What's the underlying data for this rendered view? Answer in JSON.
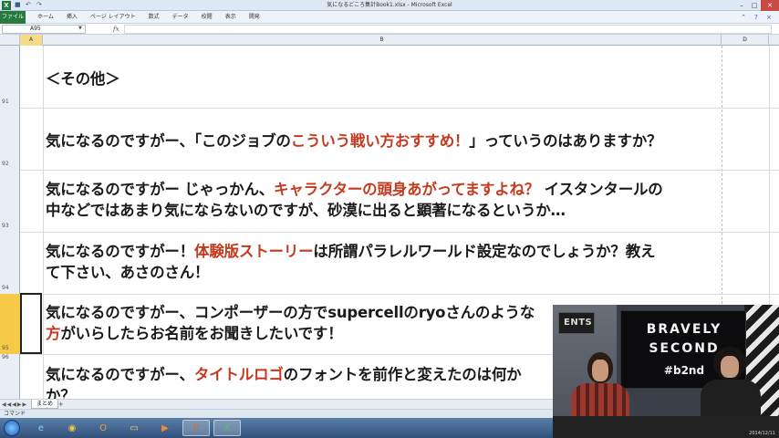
{
  "window": {
    "title": "気になるどころ集計Book1.xlsx - Microsoft Excel",
    "app_icon": "X",
    "controls": {
      "minimize": "–",
      "maximize": "□",
      "close": "✕"
    }
  },
  "ribbon": {
    "file_tab": "ファイル",
    "tabs": [
      "ホーム",
      "挿入",
      "ページ レイアウト",
      "数式",
      "データ",
      "校閲",
      "表示",
      "開発"
    ]
  },
  "formula_bar": {
    "name_box": "A95",
    "fx": "fx",
    "value": ""
  },
  "columns": [
    "A",
    "B",
    "D"
  ],
  "rows": [
    {
      "number": "91",
      "text_segments": [
        {
          "t": "＜その他＞",
          "hl": false
        }
      ]
    },
    {
      "number": "92",
      "text_segments": [
        {
          "t": "気になるのですがー、「このジョブの",
          "hl": false
        },
        {
          "t": "こういう戦い方おすすめ！",
          "hl": true
        },
        {
          "t": "」っていうのはありますか？",
          "hl": false
        }
      ]
    },
    {
      "number": "93",
      "line1": [
        {
          "t": "気になるのですがー じゃっかん、",
          "hl": false
        },
        {
          "t": "キャラクターの頭身あがってますよね？",
          "hl": true
        },
        {
          "t": " イスタンタールの",
          "hl": false
        }
      ],
      "line2": [
        {
          "t": "中などではあまり気にならないのですが、砂漠に出ると顕著になるというか…",
          "hl": false
        }
      ]
    },
    {
      "number": "94",
      "line1": [
        {
          "t": "気になるのですがー！",
          "hl": false
        },
        {
          "t": "体験版ストーリー",
          "hl": true
        },
        {
          "t": "は所謂パラレルワールド設定なのでしょうか？教え",
          "hl": false
        }
      ],
      "line2": [
        {
          "t": "て下さい、あさのさん！",
          "hl": false
        }
      ]
    },
    {
      "number": "95",
      "line1": [
        {
          "t": "気になるのですがー、コンポーザーの方でsupercellのryoさんのような",
          "hl": false
        }
      ],
      "line2": [
        {
          "t": "方",
          "hl": true
        },
        {
          "t": "がいらしたらお名前をお聞きしたいです！",
          "hl": false
        }
      ]
    },
    {
      "number": "96",
      "line1": [
        {
          "t": "気になるのですがー、",
          "hl": false
        },
        {
          "t": "タイトルロゴ",
          "hl": true
        },
        {
          "t": "のフォントを前作と変えたのは何か",
          "hl": false
        }
      ],
      "line2": [
        {
          "t": "か？",
          "hl": false
        }
      ]
    }
  ],
  "sheet_tabs": {
    "nav": "◀◀◀▶▶",
    "active": "まとめ",
    "add": "✚"
  },
  "status_bar": {
    "mode": "コマンド"
  },
  "taskbar": {
    "start": "start-orb",
    "apps": [
      {
        "name": "internet-explorer",
        "glyph": "e"
      },
      {
        "name": "chrome",
        "glyph": "◉"
      },
      {
        "name": "outlook",
        "glyph": "O"
      },
      {
        "name": "explorer",
        "glyph": "▭"
      },
      {
        "name": "media-player",
        "glyph": "▶"
      },
      {
        "name": "powerpoint",
        "glyph": "P"
      },
      {
        "name": "excel",
        "glyph": "X"
      }
    ]
  },
  "webcam": {
    "screen_line1": "BRAVELY",
    "screen_line2": "SECOND",
    "screen_line3": "#b2nd",
    "sign_text": "ENTS",
    "date": "2014/12/11"
  },
  "colors": {
    "highlight": "#c43a1f",
    "active_row": "#f7c948",
    "excel_green": "#2a7a3f"
  }
}
